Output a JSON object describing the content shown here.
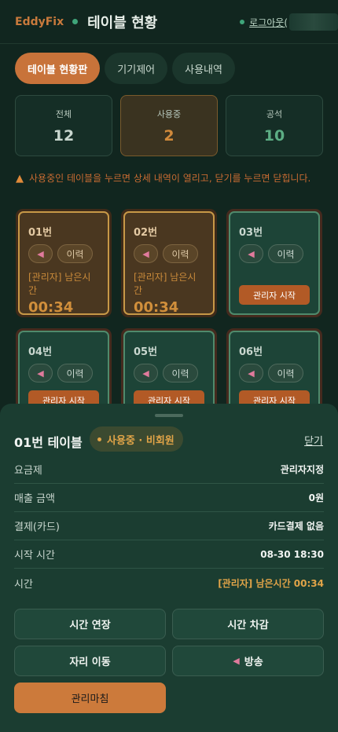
{
  "header": {
    "brand": "EddyFix",
    "title": "테이블 현황",
    "logout": "로그아웃("
  },
  "tabs": [
    {
      "label": "테이블 현황판",
      "active": true
    },
    {
      "label": "기기제어",
      "active": false
    },
    {
      "label": "사용내역",
      "active": false
    }
  ],
  "stats": [
    {
      "label": "전체",
      "value": "12"
    },
    {
      "label": "사용중",
      "value": "2"
    },
    {
      "label": "공석",
      "value": "10"
    }
  ],
  "notice": "사용중인 테이블을 누르면 상세 내역이 열리고, 닫기를 누르면 닫힙니다.",
  "cards": [
    {
      "no": "01번",
      "history": "이력",
      "status": "busy",
      "remain": "[관리자] 남은시간",
      "timer": "00:34"
    },
    {
      "no": "02번",
      "history": "이력",
      "status": "busy",
      "remain": "[관리자] 남은시간",
      "timer": "00:34"
    },
    {
      "no": "03번",
      "history": "이력",
      "status": "free",
      "action": "관리자 시작"
    },
    {
      "no": "04번",
      "history": "이력",
      "status": "free",
      "action": "관리자 시작"
    },
    {
      "no": "05번",
      "history": "이력",
      "status": "free",
      "action": "관리자 시작"
    },
    {
      "no": "06번",
      "history": "이력",
      "status": "free",
      "action": "관리자 시작"
    }
  ],
  "sheet": {
    "title": "01번 테이블",
    "badge": "사용중 · 비회원",
    "close": "닫기",
    "rows": [
      {
        "key": "요금제",
        "value": "관리자지정"
      },
      {
        "key": "매출 금액",
        "value": "0원"
      },
      {
        "key": "결제(카드)",
        "value": "카드결제 없음"
      },
      {
        "key": "시작 시간",
        "value": "08-30 18:30"
      },
      {
        "key": "시간",
        "value": "[관리자] 남은시간 00:34"
      }
    ],
    "buttons": {
      "extend": "시간 연장",
      "deduct": "시간 차감",
      "move": "자리 이동",
      "broadcast": "방송",
      "finish": "관리마침"
    }
  },
  "icons": {
    "speaker": "speaker-icon",
    "warning": "warning-icon"
  },
  "colors": {
    "accent": "#c8733a",
    "busy": "#d18f3b",
    "free": "#5cad84",
    "background": "#11261f"
  }
}
